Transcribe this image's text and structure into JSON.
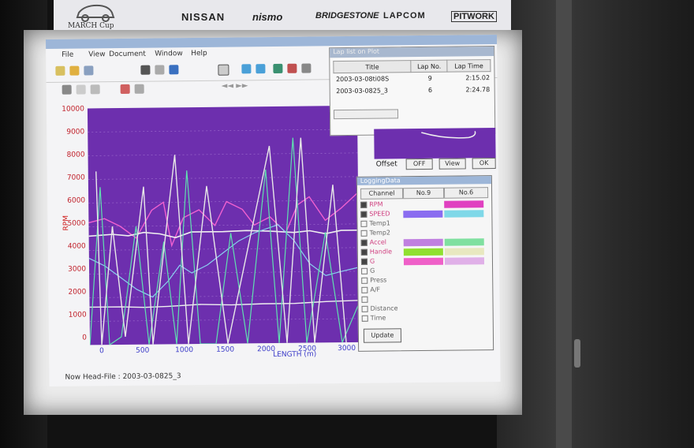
{
  "banner": {
    "logo": "MARCH Cup",
    "sponsors": [
      "NISSAN",
      "nismo",
      "BRIDGESTONE",
      "LAPCOM",
      "PITWORK"
    ]
  },
  "app": {
    "titlebar_text": "",
    "menu": [
      "File",
      "View",
      "Document",
      "Window",
      "Help"
    ],
    "y_ticks": [
      "10000",
      "9000",
      "8000",
      "7000",
      "6000",
      "5000",
      "4000",
      "3000",
      "2000",
      "1000",
      "0"
    ],
    "y_axis_label": "RPM",
    "x_ticks": [
      "0",
      "500",
      "1000",
      "1500",
      "2000",
      "2500",
      "3000"
    ],
    "x_axis_label": "LENGTH (m)",
    "status": "Now Head-File : 2003-03-0825_3"
  },
  "lap_list": {
    "title": "Lap list on Plot",
    "columns": [
      "Title",
      "Lap No.",
      "Lap Time"
    ],
    "rows": [
      {
        "title": "2003-03-08ti08S",
        "lap": "9",
        "time": "2:15.02"
      },
      {
        "title": "2003-03-0825_3",
        "lap": "6",
        "time": "2:24.78"
      }
    ]
  },
  "offset": {
    "label": "Offset",
    "off": "OFF",
    "view": "View",
    "ok": "OK"
  },
  "logging": {
    "title": "LoggingData",
    "columns": [
      "Channel",
      "No.9",
      "No.6"
    ],
    "channels": [
      {
        "name": "RPM",
        "checked": true,
        "c1": "",
        "c2": "#e040c0"
      },
      {
        "name": "SPEED",
        "checked": true,
        "c1": "#8a6cf0",
        "c2": "#7fd8e8"
      },
      {
        "name": "Temp1",
        "checked": false,
        "c1": "",
        "c2": ""
      },
      {
        "name": "Temp2",
        "checked": false,
        "c1": "",
        "c2": ""
      },
      {
        "name": "Accel",
        "checked": true,
        "c1": "#c080e0",
        "c2": "#80e0a0"
      },
      {
        "name": "Handle",
        "checked": true,
        "c1": "#90e030",
        "c2": "#e8e8c0"
      },
      {
        "name": "G",
        "checked": true,
        "c1": "#ef60c8",
        "c2": "#e0b0e8"
      },
      {
        "name": "G",
        "checked": false,
        "c1": "",
        "c2": ""
      },
      {
        "name": "Press",
        "checked": false,
        "c1": "",
        "c2": ""
      },
      {
        "name": "A/F",
        "checked": false,
        "c1": "",
        "c2": ""
      },
      {
        "name": "",
        "checked": false,
        "c1": "",
        "c2": ""
      },
      {
        "name": "Distance",
        "checked": false,
        "c1": "",
        "c2": ""
      },
      {
        "name": "Time",
        "checked": false,
        "c1": "",
        "c2": ""
      }
    ],
    "update": "Update"
  }
}
